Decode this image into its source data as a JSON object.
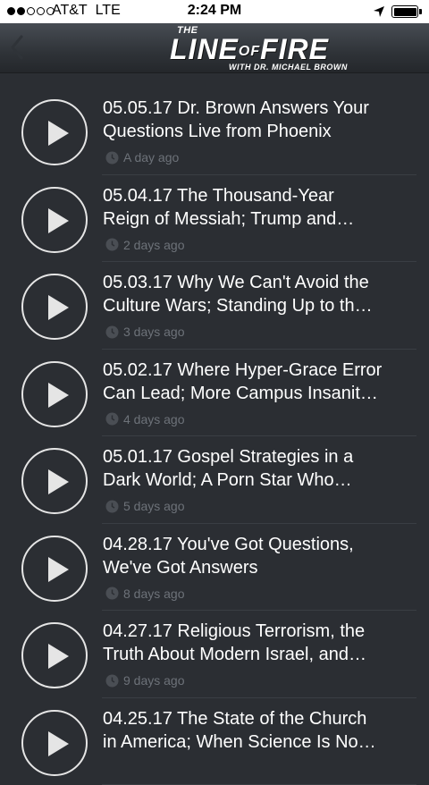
{
  "status_bar": {
    "carrier": "AT&T",
    "network": "LTE",
    "time": "2:24 PM",
    "signal_bars": 2,
    "signal_total": 5
  },
  "header": {
    "logo_the": "THE",
    "logo_line": "LINE",
    "logo_of": "OF",
    "logo_fire": "FIRE",
    "logo_sub": "WITH DR. MICHAEL BROWN"
  },
  "episodes": [
    {
      "line1": "05.05.17 Dr. Brown Answers Your",
      "line2": "Questions Live from Phoenix",
      "time": "A day ago"
    },
    {
      "line1": "05.04.17 The Thousand-Year",
      "line2": "Reign of Messiah; Trump and…",
      "time": "2 days ago"
    },
    {
      "line1": "05.03.17 Why We Can't Avoid the",
      "line2": "Culture Wars; Standing Up to th…",
      "time": "3 days ago"
    },
    {
      "line1": "05.02.17 Where Hyper-Grace Error",
      "line2": "Can Lead; More Campus Insanit…",
      "time": "4 days ago"
    },
    {
      "line1": "05.01.17 Gospel Strategies in a",
      "line2": "Dark World; A Porn Star Who…",
      "time": "5 days ago"
    },
    {
      "line1": "04.28.17 You've Got Questions,",
      "line2": "We've Got Answers",
      "time": "8 days ago"
    },
    {
      "line1": "04.27.17 Religious Terrorism, the",
      "line2": "Truth About Modern Israel, and…",
      "time": "9 days ago"
    },
    {
      "line1": "04.25.17 The State of the Church",
      "line2": "in America; When Science Is No…",
      "time": ""
    }
  ],
  "colors": {
    "background": "#2b2e33",
    "meta_text": "#6d7279",
    "divider": "#3a3e44"
  }
}
